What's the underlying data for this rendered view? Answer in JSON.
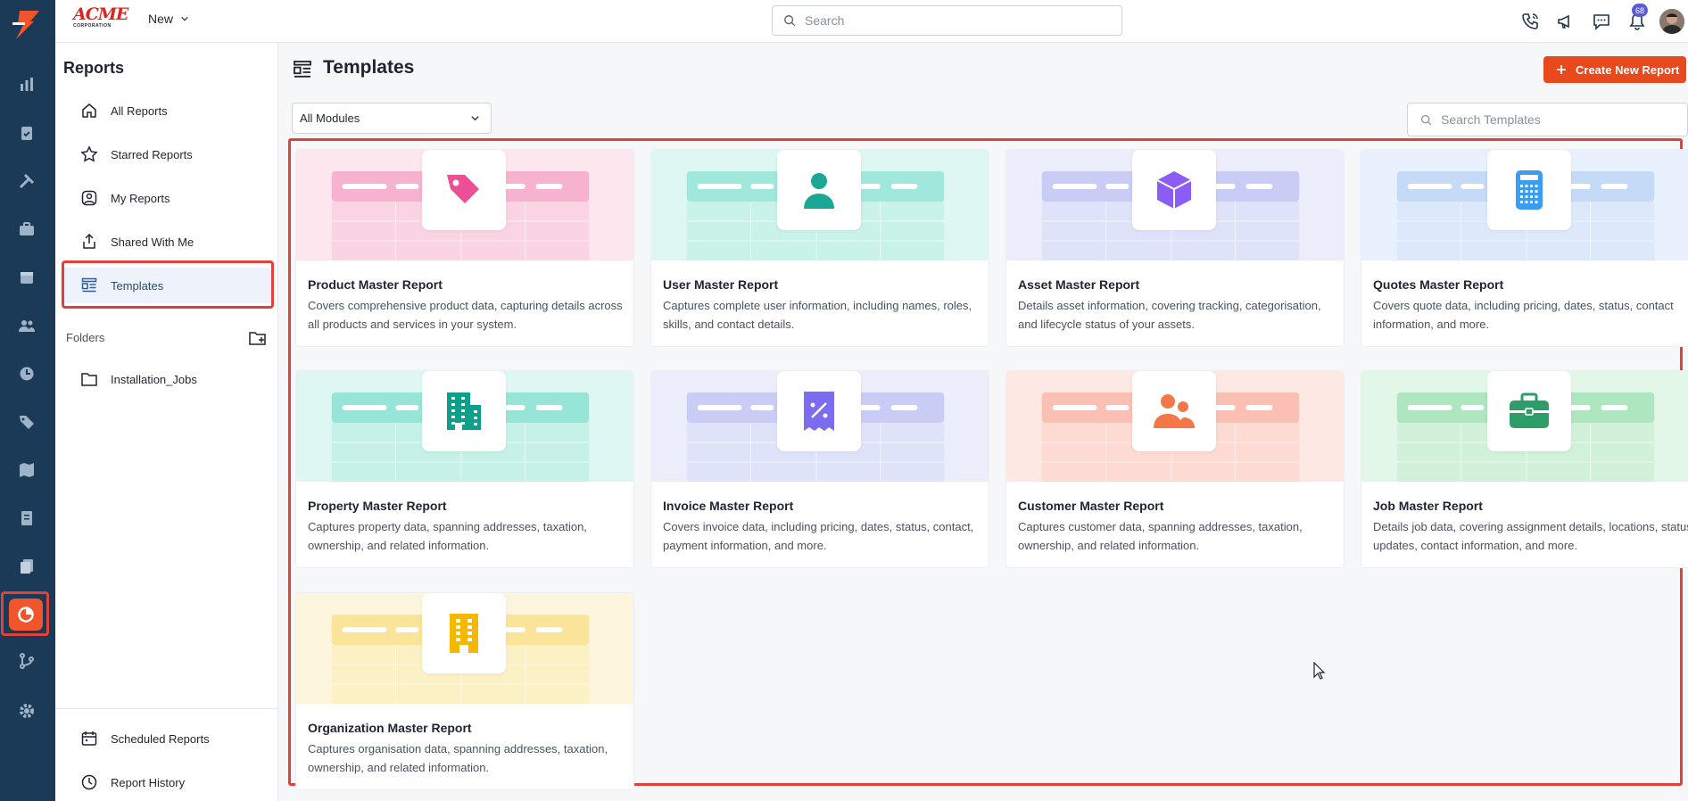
{
  "header": {
    "brand_top": "ACME",
    "brand_bottom": "CORPORATION",
    "new_label": "New",
    "search_placeholder": "Search",
    "notification_count": "68"
  },
  "sidebar": {
    "title": "Reports",
    "items": [
      {
        "label": "All Reports",
        "icon": "home-icon"
      },
      {
        "label": "Starred Reports",
        "icon": "star-icon"
      },
      {
        "label": "My Reports",
        "icon": "user-circle-icon"
      },
      {
        "label": "Shared With Me",
        "icon": "share-icon"
      },
      {
        "label": "Templates",
        "icon": "templates-icon",
        "active": true
      }
    ],
    "folders_label": "Folders",
    "folders": [
      {
        "label": "Installation_Jobs",
        "icon": "folder-icon"
      }
    ],
    "bottom_items": [
      {
        "label": "Scheduled Reports",
        "icon": "calendar-icon"
      },
      {
        "label": "Report History",
        "icon": "history-icon"
      }
    ]
  },
  "main": {
    "title": "Templates",
    "create_label": "Create New Report",
    "module_filter": "All Modules",
    "search_placeholder": "Search Templates",
    "templates": [
      {
        "title": "Product Master Report",
        "desc": "Covers comprehensive product data, capturing details across all products and services in your system.",
        "icon": "tag-icon",
        "color": "#ec4f93"
      },
      {
        "title": "User Master Report",
        "desc": "Captures complete user information, including names, roles, skills, and contact details.",
        "icon": "user-icon",
        "color": "#1aa796"
      },
      {
        "title": "Asset Master Report",
        "desc": "Details asset information, covering tracking, categorisation, and lifecycle status of your assets.",
        "icon": "cube-icon",
        "color": "#8b5cf6"
      },
      {
        "title": "Quotes Master Report",
        "desc": "Covers quote data, including pricing, dates, status, contact information, and more.",
        "icon": "calculator-icon",
        "color": "#3b9cf2"
      },
      {
        "title": "Property Master Report",
        "desc": "Captures property data, spanning addresses, taxation, ownership, and related information.",
        "icon": "building-icon",
        "color": "#0e9f8a"
      },
      {
        "title": "Invoice Master Report",
        "desc": "Covers invoice data, including pricing, dates, status, contact, payment information, and more.",
        "icon": "receipt-percent-icon",
        "color": "#7c6cf0"
      },
      {
        "title": "Customer Master Report",
        "desc": "Captures customer data, spanning addresses, taxation, ownership, and related information.",
        "icon": "users-icon",
        "color": "#f47749"
      },
      {
        "title": "Job Master Report",
        "desc": "Details job data, covering assignment details, locations, status updates, contact information, and more.",
        "icon": "briefcase-icon",
        "color": "#2e9e68"
      },
      {
        "title": "Organization Master Report",
        "desc": "Captures organisation data, spanning addresses, taxation, ownership, and related information.",
        "icon": "office-icon",
        "color": "#f5b800"
      }
    ]
  },
  "colors": {
    "accent": "#e8491d",
    "rail": "#1b3a57",
    "highlight_border": "#e0423b"
  }
}
